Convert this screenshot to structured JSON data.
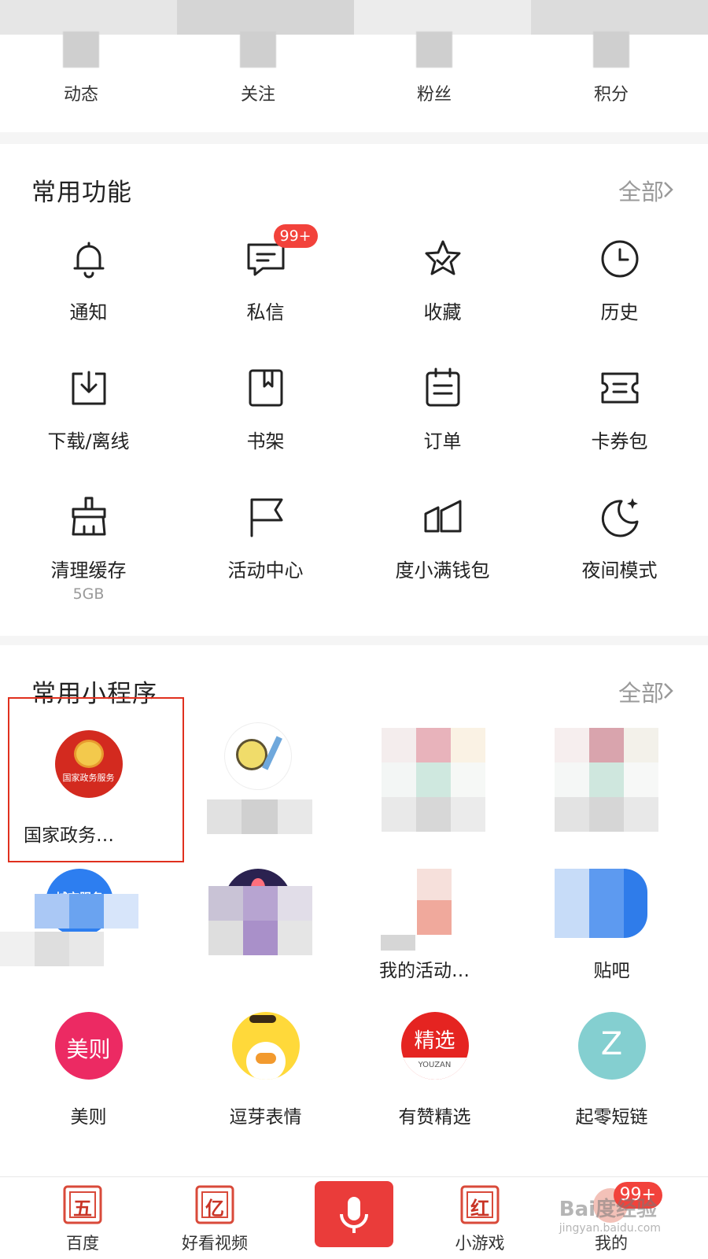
{
  "stats": [
    {
      "label": "动态"
    },
    {
      "label": "关注"
    },
    {
      "label": "粉丝"
    },
    {
      "label": "积分"
    }
  ],
  "functions": {
    "title": "常用功能",
    "more": "全部",
    "items": [
      {
        "label": "通知",
        "icon": "bell-icon"
      },
      {
        "label": "私信",
        "icon": "message-icon",
        "badge": "99+"
      },
      {
        "label": "收藏",
        "icon": "star-icon"
      },
      {
        "label": "历史",
        "icon": "clock-icon"
      },
      {
        "label": "下载/离线",
        "icon": "download-icon"
      },
      {
        "label": "书架",
        "icon": "bookshelf-icon"
      },
      {
        "label": "订单",
        "icon": "order-icon"
      },
      {
        "label": "卡券包",
        "icon": "ticket-icon"
      },
      {
        "label": "清理缓存",
        "icon": "broom-icon",
        "sub": "5GB"
      },
      {
        "label": "活动中心",
        "icon": "flag-icon"
      },
      {
        "label": "度小满钱包",
        "icon": "wallet-icon"
      },
      {
        "label": "夜间模式",
        "icon": "moon-icon"
      }
    ]
  },
  "mini_programs": {
    "title": "常用小程序",
    "more": "全部",
    "items": [
      {
        "label": "国家政务…",
        "icon": "national-emblem-icon",
        "icon_text": "国家政务服务",
        "color": "#d32a1f"
      },
      {
        "label": "",
        "icon": "film-reel-icon",
        "color": "#f3e9a8"
      },
      {
        "label": "",
        "icon": "blurred-app-icon",
        "color": "#e9a2ad"
      },
      {
        "label": "",
        "icon": "blurred-app-icon",
        "color": "#c8e6da"
      },
      {
        "label": "",
        "icon": "city-service-icon",
        "icon_text": "城市服务",
        "color": "#2d7ef0"
      },
      {
        "label": "",
        "icon": "blurred-app-icon",
        "color": "#2b2250"
      },
      {
        "label": "我的活动…",
        "icon": "blurred-app-icon",
        "color": "#f2b9ae"
      },
      {
        "label": "贴吧",
        "icon": "tieba-icon",
        "color": "#2e7df0"
      },
      {
        "label": "美则",
        "icon": "meize-icon",
        "icon_text": "美则",
        "color": "#ec2a63"
      },
      {
        "label": "逗芽表情",
        "icon": "duck-icon",
        "color": "#ffd93a"
      },
      {
        "label": "有赞精选",
        "icon": "youzan-icon",
        "icon_text": "精选",
        "icon_sub": "YOUZAN",
        "color": "#e52421"
      },
      {
        "label": "起零短链",
        "icon": "z-link-icon",
        "icon_text": "Z",
        "color": "#84cfd0"
      }
    ]
  },
  "tabbar": {
    "items": [
      {
        "label": "百度",
        "icon": "wu-icon",
        "icon_text": "五"
      },
      {
        "label": "好看视频",
        "icon": "yi-icon",
        "icon_text": "亿"
      },
      {
        "label": "",
        "icon": "microphone-icon"
      },
      {
        "label": "小游戏",
        "icon": "hong-icon",
        "icon_text": "红"
      },
      {
        "label": "我的",
        "icon": "avatar-icon",
        "badge": "99+"
      }
    ],
    "watermark": "Bai度经验",
    "watermark_sub": "jingyan.baidu.com",
    "accent": "#ea3c3a"
  }
}
